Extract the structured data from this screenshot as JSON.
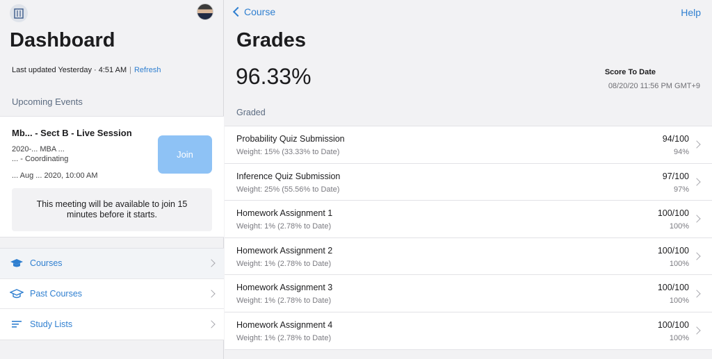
{
  "left": {
    "title": "Dashboard",
    "last_updated": "Last updated Yesterday · 4:51 AM",
    "refresh": "Refresh",
    "upcoming_events": "Upcoming Events",
    "event": {
      "title": "Mb... - Sect B - Live Session",
      "line1": "2020-... MBA ...",
      "line2": "... - Coordinating",
      "line3": "... Aug ... 2020, 10:00 AM",
      "join": "Join",
      "notice": "This meeting will be available to join 15 minutes before it starts."
    },
    "nav": [
      {
        "label": "Courses",
        "icon": "graduation-cap-icon"
      },
      {
        "label": "Past Courses",
        "icon": "graduation-cap-outline-icon"
      },
      {
        "label": "Study Lists",
        "icon": "list-icon"
      }
    ]
  },
  "right": {
    "back": "Course",
    "help": "Help",
    "title": "Grades",
    "score": "96.33%",
    "score_label": "Score To Date",
    "score_date": "08/20/20 11:56 PM GMT+9",
    "section": "Graded",
    "items": [
      {
        "name": "Probability Quiz Submission",
        "weight": "Weight: 15% (33.33% to Date)",
        "points": "94/100",
        "percent": "94%"
      },
      {
        "name": "Inference Quiz Submission",
        "weight": "Weight: 25% (55.56% to Date)",
        "points": "97/100",
        "percent": "97%"
      },
      {
        "name": "Homework Assignment 1",
        "weight": "Weight: 1% (2.78% to Date)",
        "points": "100/100",
        "percent": "100%"
      },
      {
        "name": "Homework Assignment 2",
        "weight": "Weight: 1% (2.78% to Date)",
        "points": "100/100",
        "percent": "100%"
      },
      {
        "name": "Homework Assignment 3",
        "weight": "Weight: 1% (2.78% to Date)",
        "points": "100/100",
        "percent": "100%"
      },
      {
        "name": "Homework Assignment 4",
        "weight": "Weight: 1% (2.78% to Date)",
        "points": "100/100",
        "percent": "100%"
      }
    ]
  },
  "colors": {
    "accent": "#2f7fd0",
    "join_button": "#8ec2f5"
  }
}
